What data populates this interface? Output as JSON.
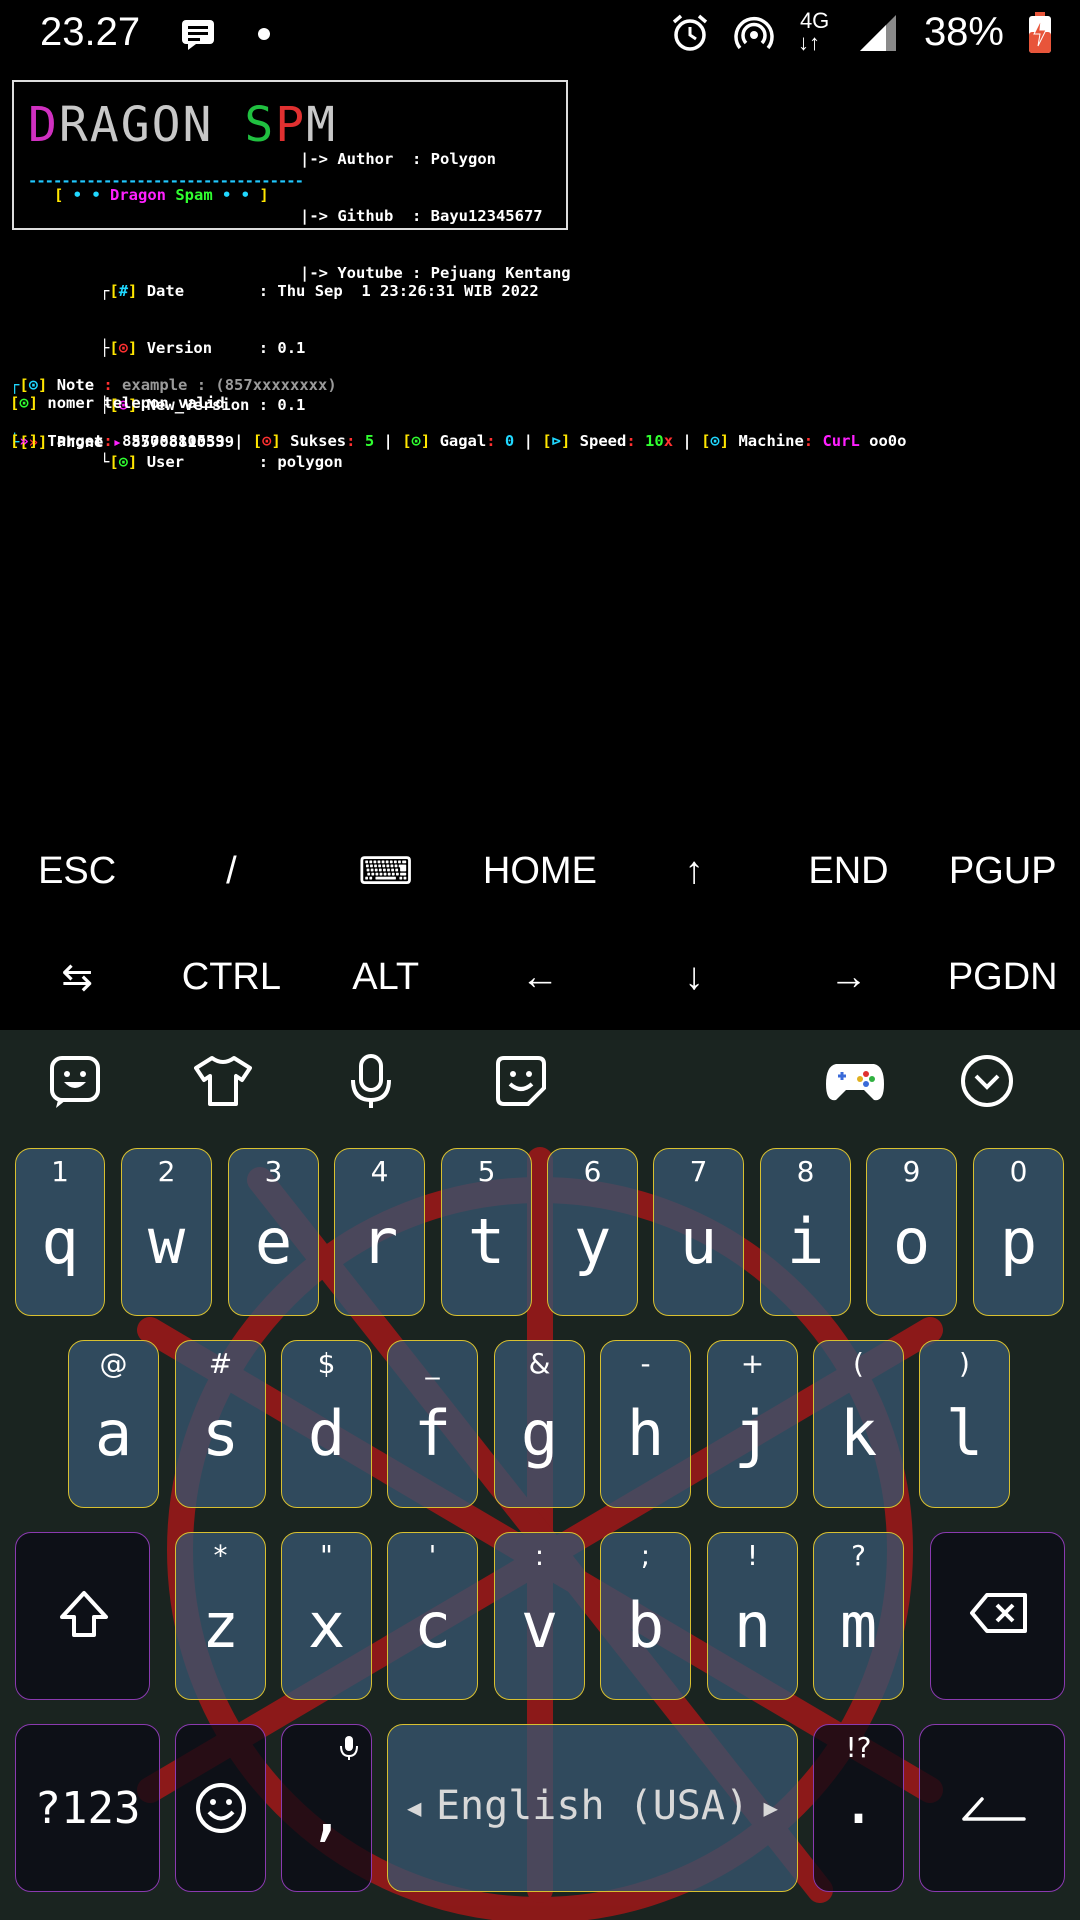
{
  "status_bar": {
    "time": "23.27",
    "battery": "38%",
    "network": "4G"
  },
  "terminal": {
    "banner": {
      "logo_text": "DRAGON SPM",
      "author_label": "|-> Author  : ",
      "author": "Polygon",
      "github_label": "|-> Github  : ",
      "github": "Bayu12345677",
      "youtube_label": "|-> Youtube : ",
      "youtube": "Pejuang Kentang",
      "divider": "---------------------------------",
      "tag_open": "[ ",
      "tag_dots_left": "• • ",
      "tag_dragon": "Dragon ",
      "tag_spam": "Spam",
      "tag_dots_right": " • • ",
      "tag_close": "]"
    },
    "info": [
      {
        "prefix": "┌",
        "icon": "#",
        "key": "Date       ",
        "value": "Thu Sep  1 23:26:31 WIB 2022"
      },
      {
        "prefix": "├",
        "icon": "⊙",
        "key": "Version    ",
        "value": "0.1"
      },
      {
        "prefix": "├",
        "icon": "⊙",
        "key": "New_Version",
        "value": "0.1"
      },
      {
        "prefix": "└",
        "icon": "⊙",
        "key": "User       ",
        "value": "polygon"
      }
    ],
    "note_label": "Note",
    "note_sep": " : ",
    "note_text": "example : (857xxxxxxxx)",
    "phone_label": "Phone",
    "phone_sep": " ▸ ",
    "phone_value": "85708810539",
    "valid_icon": "⊙",
    "valid_text": "nomer telepon valid",
    "target": {
      "target_label": "Target",
      "target_value": "85708810539",
      "sukses_label": "Sukses",
      "sukses_value": "5",
      "gagal_label": "Gagal",
      "gagal_value": "0",
      "speed_label": "Speed",
      "speed_value": "10",
      "speed_unit": "x",
      "machine_label": "Machine",
      "machine_value": "CurL",
      "spinner": "oo0o"
    }
  },
  "extra_keys": {
    "row1": [
      "ESC",
      "/",
      "⌨",
      "HOME",
      "↑",
      "END",
      "PGUP"
    ],
    "row2": [
      "⇆",
      "CTRL",
      "ALT",
      "←",
      "↓",
      "→",
      "PGDN"
    ]
  },
  "keyboard": {
    "toolbar": [
      "sticker-icon",
      "theme-icon",
      "microphone-icon",
      "emoji-sticker-icon",
      "gamepad-icon",
      "collapse-icon"
    ],
    "row1": [
      {
        "hint": "1",
        "key": "q"
      },
      {
        "hint": "2",
        "key": "w"
      },
      {
        "hint": "3",
        "key": "e"
      },
      {
        "hint": "4",
        "key": "r"
      },
      {
        "hint": "5",
        "key": "t"
      },
      {
        "hint": "6",
        "key": "y"
      },
      {
        "hint": "7",
        "key": "u"
      },
      {
        "hint": "8",
        "key": "i"
      },
      {
        "hint": "9",
        "key": "o"
      },
      {
        "hint": "0",
        "key": "p"
      }
    ],
    "row2": [
      {
        "hint": "@",
        "key": "a"
      },
      {
        "hint": "#",
        "key": "s"
      },
      {
        "hint": "$",
        "key": "d"
      },
      {
        "hint": "_",
        "key": "f"
      },
      {
        "hint": "&",
        "key": "g"
      },
      {
        "hint": "-",
        "key": "h"
      },
      {
        "hint": "+",
        "key": "j"
      },
      {
        "hint": "(",
        "key": "k"
      },
      {
        "hint": ")",
        "key": "l"
      }
    ],
    "row3": [
      {
        "hint": "*",
        "key": "z"
      },
      {
        "hint": "\"",
        "key": "x"
      },
      {
        "hint": "'",
        "key": "c"
      },
      {
        "hint": ":",
        "key": "v"
      },
      {
        "hint": ";",
        "key": "b"
      },
      {
        "hint": "!",
        "key": "n"
      },
      {
        "hint": "?",
        "key": "m"
      }
    ],
    "symbols_label": "?123",
    "comma_label": ",",
    "space_label": "English (USA)",
    "period_hint": "!?",
    "period_label": "."
  }
}
